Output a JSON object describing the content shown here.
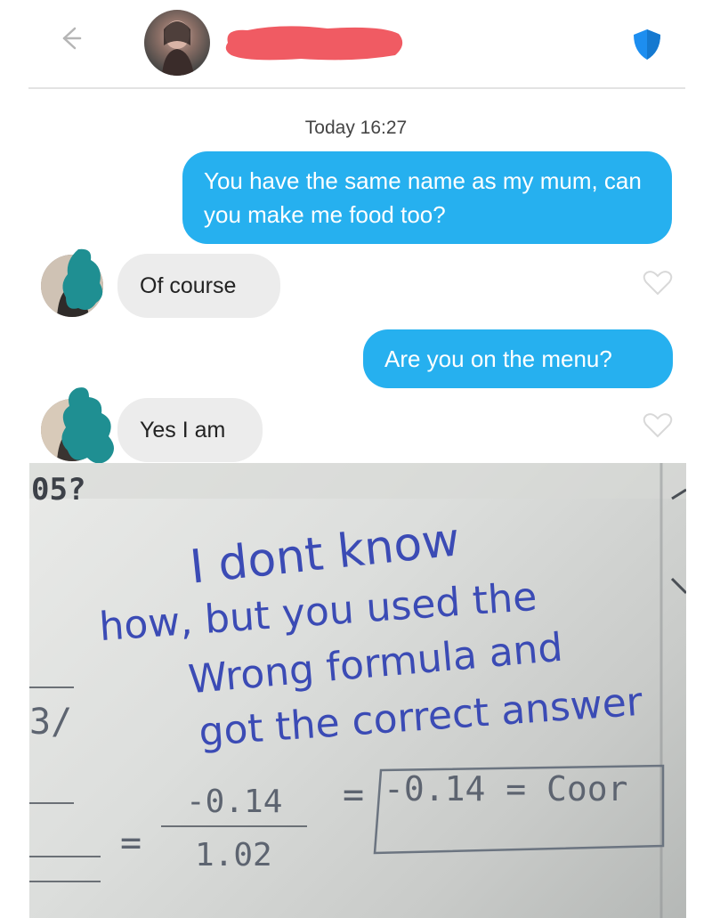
{
  "header": {
    "back_icon": "back-arrow-icon",
    "verified_icon": "shield-icon",
    "accent": "#1d8ef0"
  },
  "chat": {
    "timestamp": "Today 16:27",
    "messages": [
      {
        "from": "me",
        "text": "You have the same name as my mum, can you make me food too?"
      },
      {
        "from": "them",
        "text": "Of course"
      },
      {
        "from": "me",
        "text": "Are you on the menu?"
      },
      {
        "from": "them",
        "text": "Yes I am"
      }
    ],
    "colors": {
      "outgoing": "#26b0ef",
      "incoming": "#ececec"
    }
  },
  "photo": {
    "question_number": "05?",
    "handwriting": [
      "I dont know",
      "how, but you used the",
      "Wrong formula and",
      "got the correct answer"
    ],
    "fraction_fragment": "3/",
    "numerator": "-0.14",
    "denominator": "1.02",
    "equals": "=",
    "boxed_answer": "-0.14 = Coor",
    "ink_color": "#3b4bb5"
  }
}
